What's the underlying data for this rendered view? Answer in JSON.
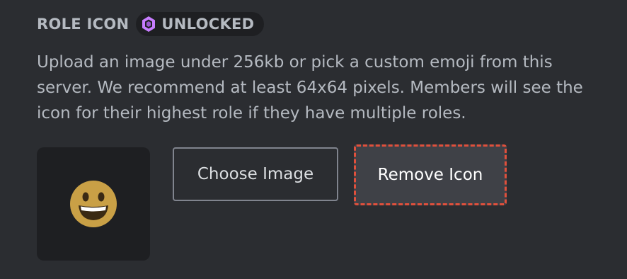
{
  "section": {
    "title": "ROLE ICON",
    "badge": {
      "icon": "boost-gem-icon",
      "label": "UNLOCKED",
      "color": "#c77dff"
    }
  },
  "description": "Upload an image under 256kb or pick a custom emoji from this server. We recommend at least 64x64 pixels. Members will see the icon for their highest role if they have multiple roles.",
  "preview": {
    "icon": "grinning-face-emoji-icon"
  },
  "buttons": {
    "choose_image": "Choose Image",
    "remove_icon": "Remove Icon"
  },
  "colors": {
    "background": "#2b2d31",
    "preview_background": "#1e1f22",
    "remove_button_background": "#3f4147",
    "highlight_border": "#e0503c"
  }
}
